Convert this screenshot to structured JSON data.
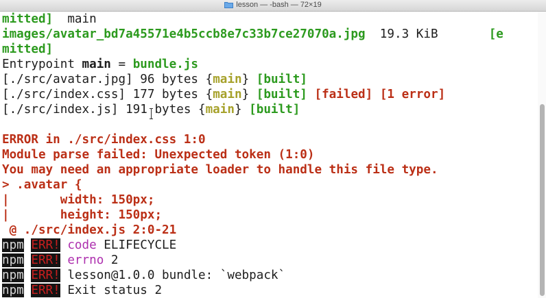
{
  "window": {
    "title": "lesson — -bash — 72×19",
    "folder_icon": "folder-icon"
  },
  "terminal": {
    "line1": {
      "word": "mitted]",
      "rest": "  main"
    },
    "line2": {
      "file": "images/avatar_bd7a45571e4b5ccb8e7c33b7ce27070a.jpg",
      "size": "  19.3 KiB",
      "gap": "       ",
      "tail": "[e"
    },
    "line3": {
      "word": "mitted]"
    },
    "line4": {
      "prefix": "Entrypoint ",
      "chunk": "main",
      "eq": " = ",
      "bundle": "bundle.js"
    },
    "module1": {
      "path": "[./src/avatar.jpg]",
      "size": " 96 bytes {",
      "chunk": "main",
      "close": "} ",
      "built": "[built]"
    },
    "module2": {
      "path": "[./src/index.css]",
      "size": " 177 bytes {",
      "chunk": "main",
      "close": "} ",
      "built": "[built]",
      "failed": "[failed]",
      "errors": "[1 error]"
    },
    "module3": {
      "path": "[./src/index.js]",
      "size": " 191 bytes {",
      "chunk": "main",
      "close": "} ",
      "built": "[built]"
    },
    "error_header": "ERROR in ./src/index.css 1:0",
    "error_parse": "Module parse failed: Unexpected token (1:0)",
    "error_hint": "You may need an appropriate loader to handle this file type.",
    "code_line1": "> .avatar {",
    "code_line2": "|       width: 150px;",
    "code_line3": "|       height: 150px;",
    "code_at": " @ ./src/index.js 2:0-21",
    "npm_log": [
      {
        "npm": "npm",
        "err": "ERR!",
        "key": "code",
        "value": " ELIFECYCLE"
      },
      {
        "npm": "npm",
        "err": "ERR!",
        "key": "errno",
        "value": " 2"
      },
      {
        "npm": "npm",
        "err": "ERR!",
        "key": "",
        "value": "lesson@1.0.0 bundle: `webpack`"
      },
      {
        "npm": "npm",
        "err": "ERR!",
        "key": "",
        "value": "Exit status 2"
      }
    ]
  },
  "colors": {
    "green": "#2c9a1e",
    "yellow": "#a6a12a",
    "red": "#bb2f16",
    "magenta": "#ad2fae"
  }
}
